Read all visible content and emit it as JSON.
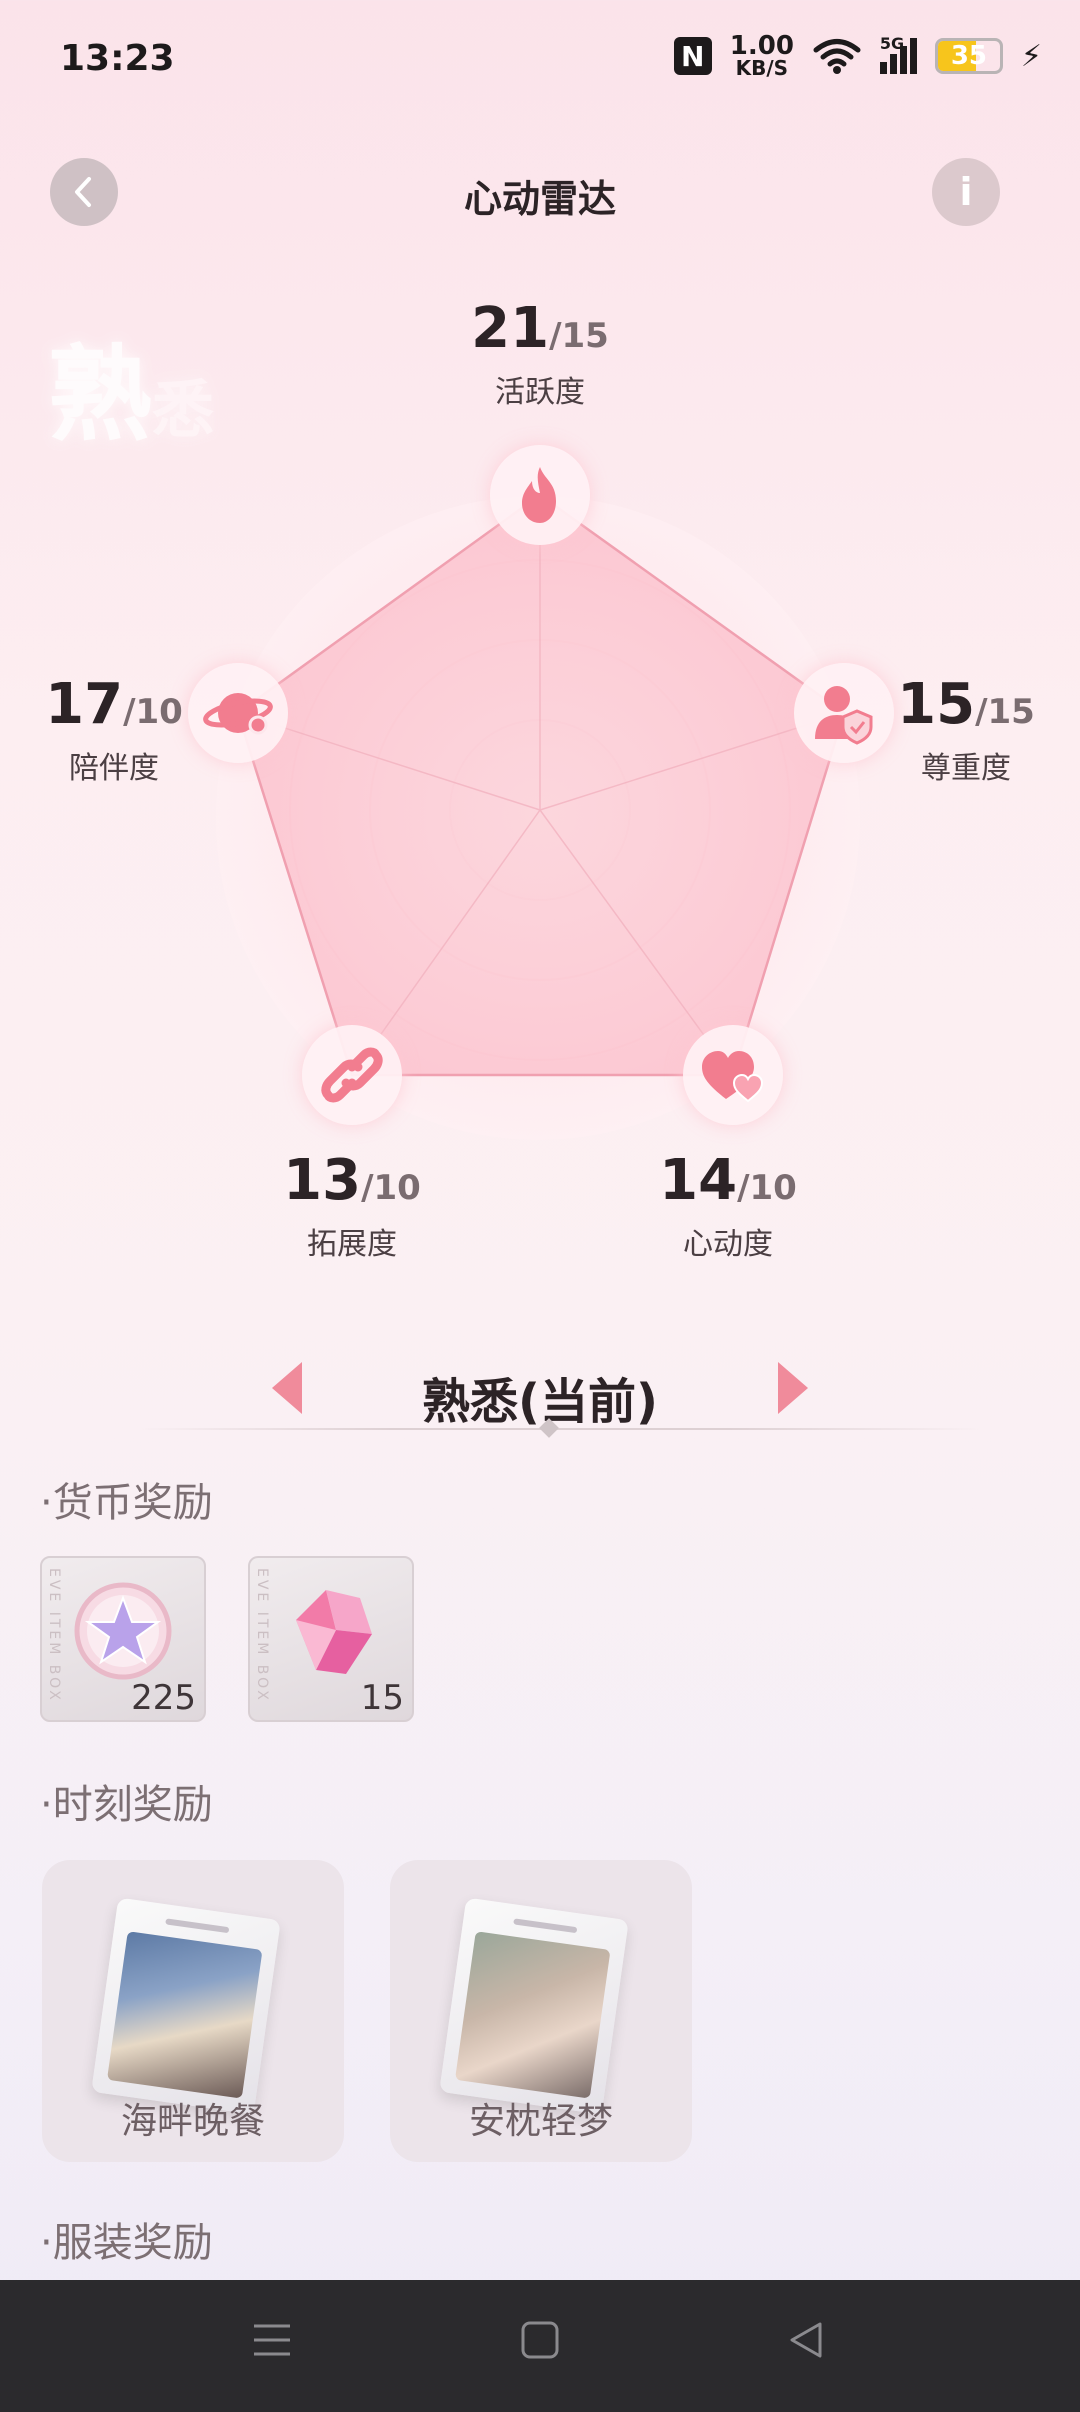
{
  "status_bar": {
    "time": "13:23",
    "nfc": "N",
    "net_speed_value": "1.00",
    "net_speed_unit": "KB/S",
    "network": "5G",
    "battery": "35",
    "icons": [
      "nfc-icon",
      "wifi-icon",
      "signal-icon",
      "battery-icon",
      "charging-icon"
    ]
  },
  "header": {
    "title": "心动雷达",
    "back_icon": "chevron-left-icon",
    "info_label": "i"
  },
  "current_level_watermark": {
    "main": "熟",
    "sub": "悉"
  },
  "radar": {
    "stats": [
      {
        "key": "activity",
        "label": "活跃度",
        "value": "21",
        "max": "/15",
        "icon": "flame-icon"
      },
      {
        "key": "respect",
        "label": "尊重度",
        "value": "15",
        "max": "/15",
        "icon": "user-shield-icon"
      },
      {
        "key": "heartbeat",
        "label": "心动度",
        "value": "14",
        "max": "/10",
        "icon": "hearts-icon"
      },
      {
        "key": "expansion",
        "label": "拓展度",
        "value": "13",
        "max": "/10",
        "icon": "link-icon"
      },
      {
        "key": "companion",
        "label": "陪伴度",
        "value": "17",
        "max": "/10",
        "icon": "planet-icon"
      }
    ],
    "colors": {
      "fill": "#fcc6d0",
      "stroke": "#f0a0b0",
      "icon": "#f27d8f"
    }
  },
  "level_switch": {
    "title": "熟悉(当前)",
    "prev_icon": "arrow-left-icon",
    "next_icon": "arrow-right-icon"
  },
  "rewards": {
    "currency": {
      "title": "·货币奖励",
      "items": [
        {
          "name": "star-coin",
          "qty": "225",
          "icon": "star-coin-icon"
        },
        {
          "name": "pink-crystal",
          "qty": "15",
          "icon": "crystal-icon"
        }
      ],
      "card_deco": "EVE ITEM BOX"
    },
    "moments": {
      "title": "·时刻奖励",
      "items": [
        {
          "label": "海畔晚餐"
        },
        {
          "label": "安枕轻梦"
        }
      ]
    },
    "outfits": {
      "title": "·服装奖励"
    }
  },
  "nav_bar": {
    "icons": [
      "menu-icon",
      "home-icon",
      "back-triangle-icon"
    ]
  }
}
